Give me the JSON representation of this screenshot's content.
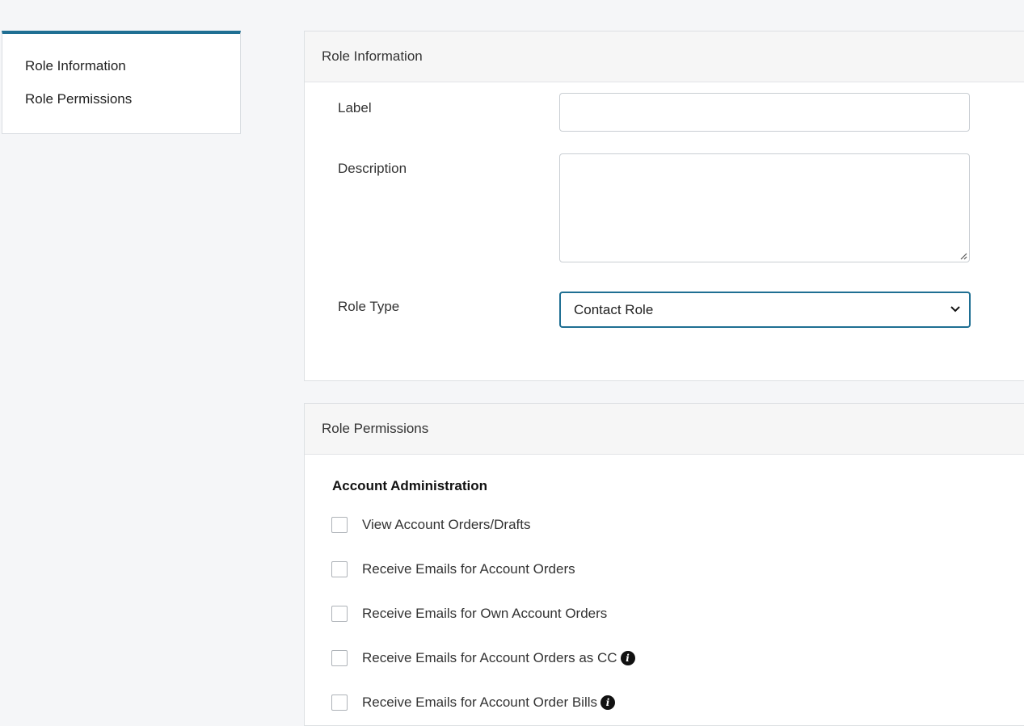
{
  "nav": {
    "items": [
      {
        "label": "Role Information"
      },
      {
        "label": "Role Permissions"
      }
    ]
  },
  "role_information": {
    "header": "Role Information",
    "label_field": {
      "label": "Label",
      "value": ""
    },
    "description_field": {
      "label": "Description",
      "value": ""
    },
    "role_type_field": {
      "label": "Role Type",
      "selected": "Contact Role"
    }
  },
  "role_permissions": {
    "header": "Role Permissions",
    "section_title": "Account Administration",
    "items": [
      {
        "label": "View Account Orders/Drafts",
        "checked": false,
        "info": false
      },
      {
        "label": "Receive Emails for Account Orders",
        "checked": false,
        "info": false
      },
      {
        "label": "Receive Emails for Own Account Orders",
        "checked": false,
        "info": false
      },
      {
        "label": "Receive Emails for Account Orders as CC",
        "checked": false,
        "info": true
      },
      {
        "label": "Receive Emails for Account Order Bills",
        "checked": false,
        "info": true
      }
    ]
  },
  "colors": {
    "accent": "#1f6f93",
    "background": "#f5f6f8"
  }
}
